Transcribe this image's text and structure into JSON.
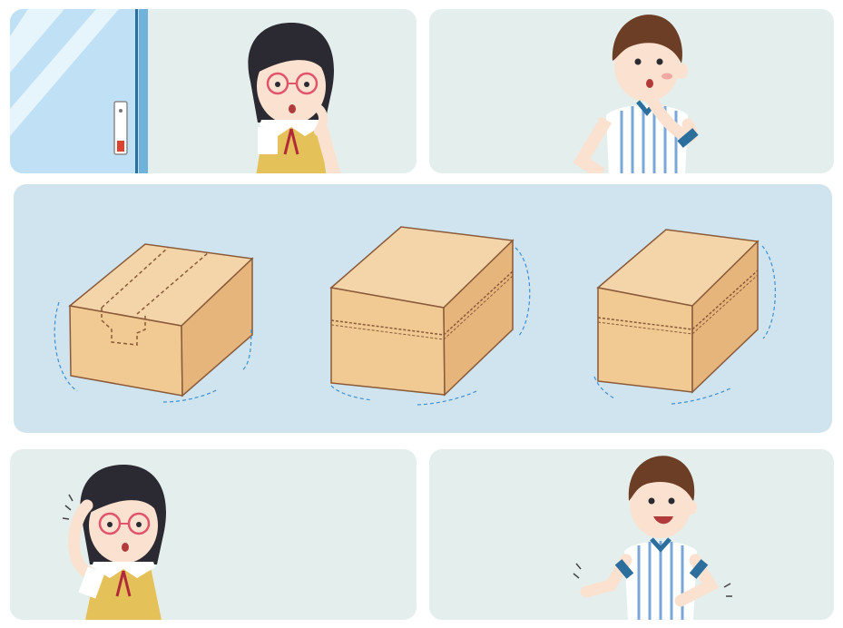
{
  "colors": {
    "panel_bg": "#e4efed",
    "middle_bg": "#cfe4ee",
    "box_top": "#f3d5a9",
    "box_front": "#f0c993",
    "box_side": "#e6b57c",
    "box_edge": "#8a5a3a",
    "motion_lines": "#3f8fd6"
  },
  "panels": [
    {
      "name": "girl-at-door-thinking",
      "icons": [
        "glass-door-icon",
        "door-handle-icon",
        "girl-thinking-icon"
      ]
    },
    {
      "name": "boy-thinking",
      "icons": [
        "boy-thinking-icon"
      ]
    },
    {
      "name": "three-cardboard-boxes",
      "icons": [
        "box-taped-top-icon",
        "box-taped-horizontal-icon",
        "box-taped-side-icon"
      ]
    },
    {
      "name": "girl-scratching-head",
      "icons": [
        "girl-confused-icon"
      ]
    },
    {
      "name": "boy-explaining",
      "icons": [
        "boy-explaining-icon"
      ]
    }
  ]
}
